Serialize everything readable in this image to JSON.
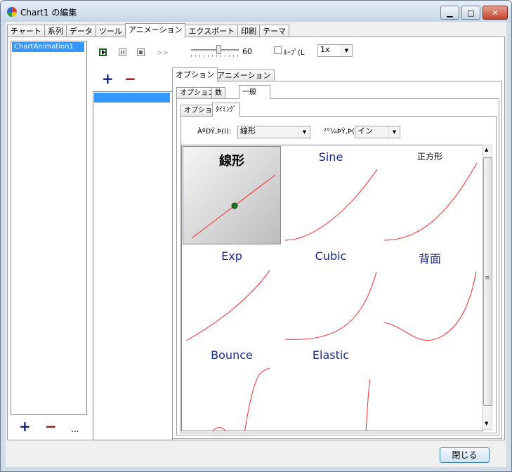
{
  "window": {
    "title": "Chart1 の編集",
    "minimize_glyph": "▁",
    "maximize_glyph": "□",
    "close_glyph": "✕"
  },
  "tabs": [
    {
      "label": "チャート"
    },
    {
      "label": "系列"
    },
    {
      "label": "データ"
    },
    {
      "label": "ツール"
    },
    {
      "label": "アニメーション",
      "active": true
    },
    {
      "label": "エクスポート"
    },
    {
      "label": "印刷"
    },
    {
      "label": "テーマ"
    }
  ],
  "animation_list": {
    "items": [
      "ChartAnimation1"
    ],
    "add": "+",
    "remove": "−",
    "more": "..."
  },
  "playback": {
    "forward": ">>",
    "speed_value": "60",
    "loop_label": "ﾙｰﾌﾟ(L",
    "rate": "1x",
    "slider_fraction": 0.55
  },
  "sub_list": {
    "add": "+",
    "remove": "−"
  },
  "option_tabs": [
    "オプション",
    "アニメーション"
  ],
  "inner_tabs": [
    "オプション",
    "数",
    "一般"
  ],
  "timing_tabs": [
    "オプション",
    "ﾀｲﾐﾝｸﾞ"
  ],
  "timing": {
    "label1": "ÀºÐÝ,Þ(I):",
    "value1": "線形",
    "label2": "²°¼ÞÝ,Þ(",
    "value2": "イン"
  },
  "easing": [
    {
      "name": "線形",
      "selected": true
    },
    {
      "name": "Sine"
    },
    {
      "name": "正方形"
    },
    {
      "name": "Exp"
    },
    {
      "name": "Cubic"
    },
    {
      "name": "背面"
    },
    {
      "name": "Bounce"
    },
    {
      "name": "Elastic"
    }
  ],
  "scroll": {
    "grip": "≡"
  },
  "footer": {
    "close_label": "閉じる"
  },
  "colors": {
    "curve": "#ff2b2b",
    "marker": "#1f7a1f",
    "selection": "#3399ff"
  }
}
